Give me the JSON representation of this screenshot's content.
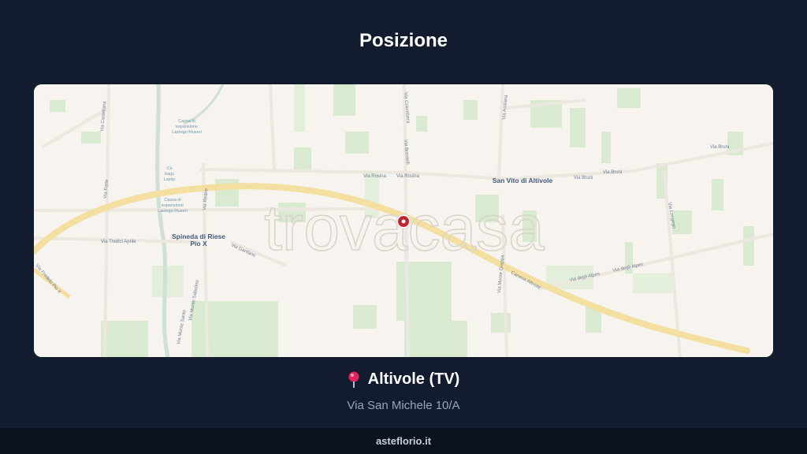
{
  "header": {
    "title": "Posizione"
  },
  "map": {
    "watermark": "trovacasa",
    "marker": "location-marker",
    "places": {
      "spineda_line1": "Spineda di Riese",
      "spineda_line2": "Pio X",
      "san_vito": "San Vito di Altivole"
    },
    "streets": {
      "via_rosina_1": "Via Rosina",
      "via_rosina_2": "Via Rosina",
      "via_bruni_1": "Via Bruni",
      "via_bruni_2": "Via Bruni",
      "via_bruni_3": "Via Bruni",
      "via_tredici_aprile": "Via Tredici Aprile",
      "via_castellana": "Via Castellana",
      "via_forte": "Via Forte",
      "via_reane": "Via Reane",
      "via_gardane": "Via Gardane",
      "via_monte_grappa": "Via Monte Grappa",
      "caneria_altivole": "Caneria Altivole",
      "via_degli_alpini_1": "Via degli Alpini",
      "via_degli_alpini_2": "Via degli Alpini",
      "via_longego": "Via Longego",
      "via_asolana": "Via Asolana",
      "via_brentelli": "Via Brentelli",
      "via_colombera": "Via Colombera",
      "via_monte_santo": "Via Monte Santo",
      "via_monte_sabotino": "Via Monte Sabotino",
      "via_fredelo_pio_x": "Via Fredelo Pio X"
    },
    "pois": {
      "museo1_l1": "Cassa di",
      "museo1_l2": "espansione",
      "museo1_l3": "Lastego Museri",
      "museo2_l1": "Cassa di",
      "museo2_l2": "espansione",
      "museo2_l3": "Lastego Museri",
      "ca_l1": "Cà",
      "ca_l2": "bags",
      "ca_l3": "Lastip"
    }
  },
  "location": {
    "name": "Altivole (TV)",
    "address": "Via San Michele 10/A"
  },
  "footer": {
    "site": "asteflorio.it"
  },
  "colors": {
    "background": "#131c2e",
    "map_land": "#f7f3ee",
    "highway": "#f3dfa0",
    "field_green": "#d9ead0",
    "marker_red": "#c0242c",
    "footer_bg": "#0c1220"
  }
}
